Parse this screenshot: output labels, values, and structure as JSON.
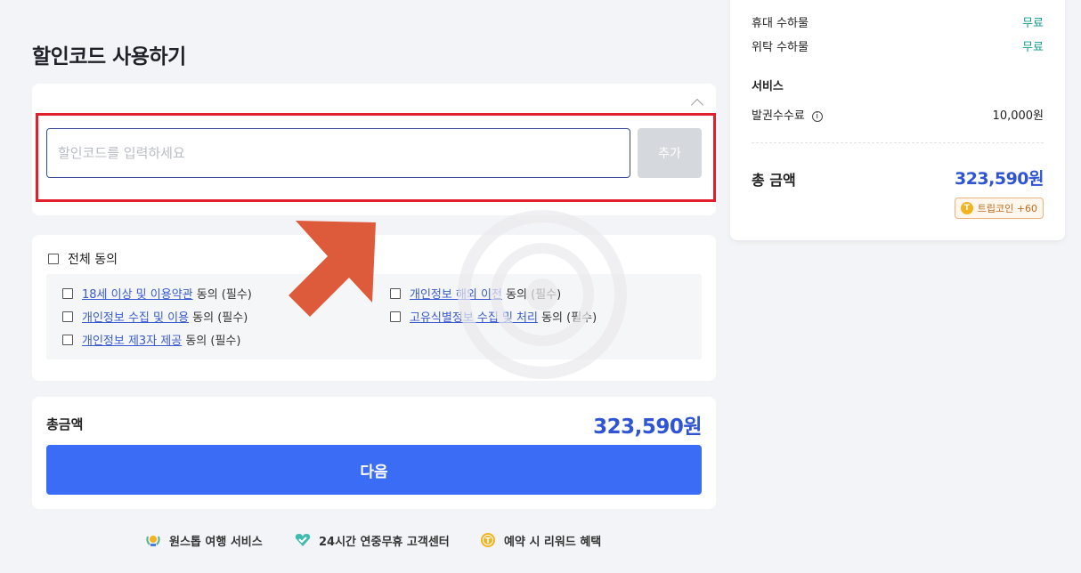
{
  "page": {
    "title": "할인코드 사용하기"
  },
  "discount": {
    "placeholder": "할인코드를 입력하세요",
    "add_label": "추가"
  },
  "terms": {
    "all_label": "전체 동의",
    "items": [
      {
        "link": "18세 이상 및 이용약관",
        "suffix": " 동의 (필수)"
      },
      {
        "link": "개인정보 수집 및 이용",
        "suffix": " 동의 (필수)"
      },
      {
        "link": "개인정보 제3자 제공",
        "suffix": " 동의 (필수)"
      },
      {
        "link": "개인정보 해외 이전",
        "suffix": " 동의 (필수)"
      },
      {
        "link": "고유식별정보 수집 및 처리",
        "suffix": " 동의 (필수)"
      }
    ]
  },
  "total": {
    "label": "총금액",
    "value": "323,590원",
    "next_label": "다음"
  },
  "features": [
    {
      "icon": "laurel-badge-icon",
      "label": "원스톱 여행 서비스"
    },
    {
      "icon": "heart-check-icon",
      "label": "24시간 연중무휴 고객센터"
    },
    {
      "icon": "coin-icon",
      "label": "예약 시 리워드 혜택"
    }
  ],
  "summary": {
    "rows": [
      {
        "label": "휴대 수하물",
        "value": "무료"
      },
      {
        "label": "위탁 수하물",
        "value": "무료"
      }
    ],
    "service_heading": "서비스",
    "fee_label": "발권수수료",
    "fee_value": "10,000원",
    "grand_label": "총 금액",
    "grand_value": "323,590원",
    "coin_label": "트립코인 +60",
    "coin_icon_letter": "T"
  },
  "colors": {
    "accent": "#3a6cf6",
    "price": "#2f55d4",
    "free": "#159b8e",
    "highlight": "#e0202a",
    "arrow": "#dd5b3a"
  }
}
